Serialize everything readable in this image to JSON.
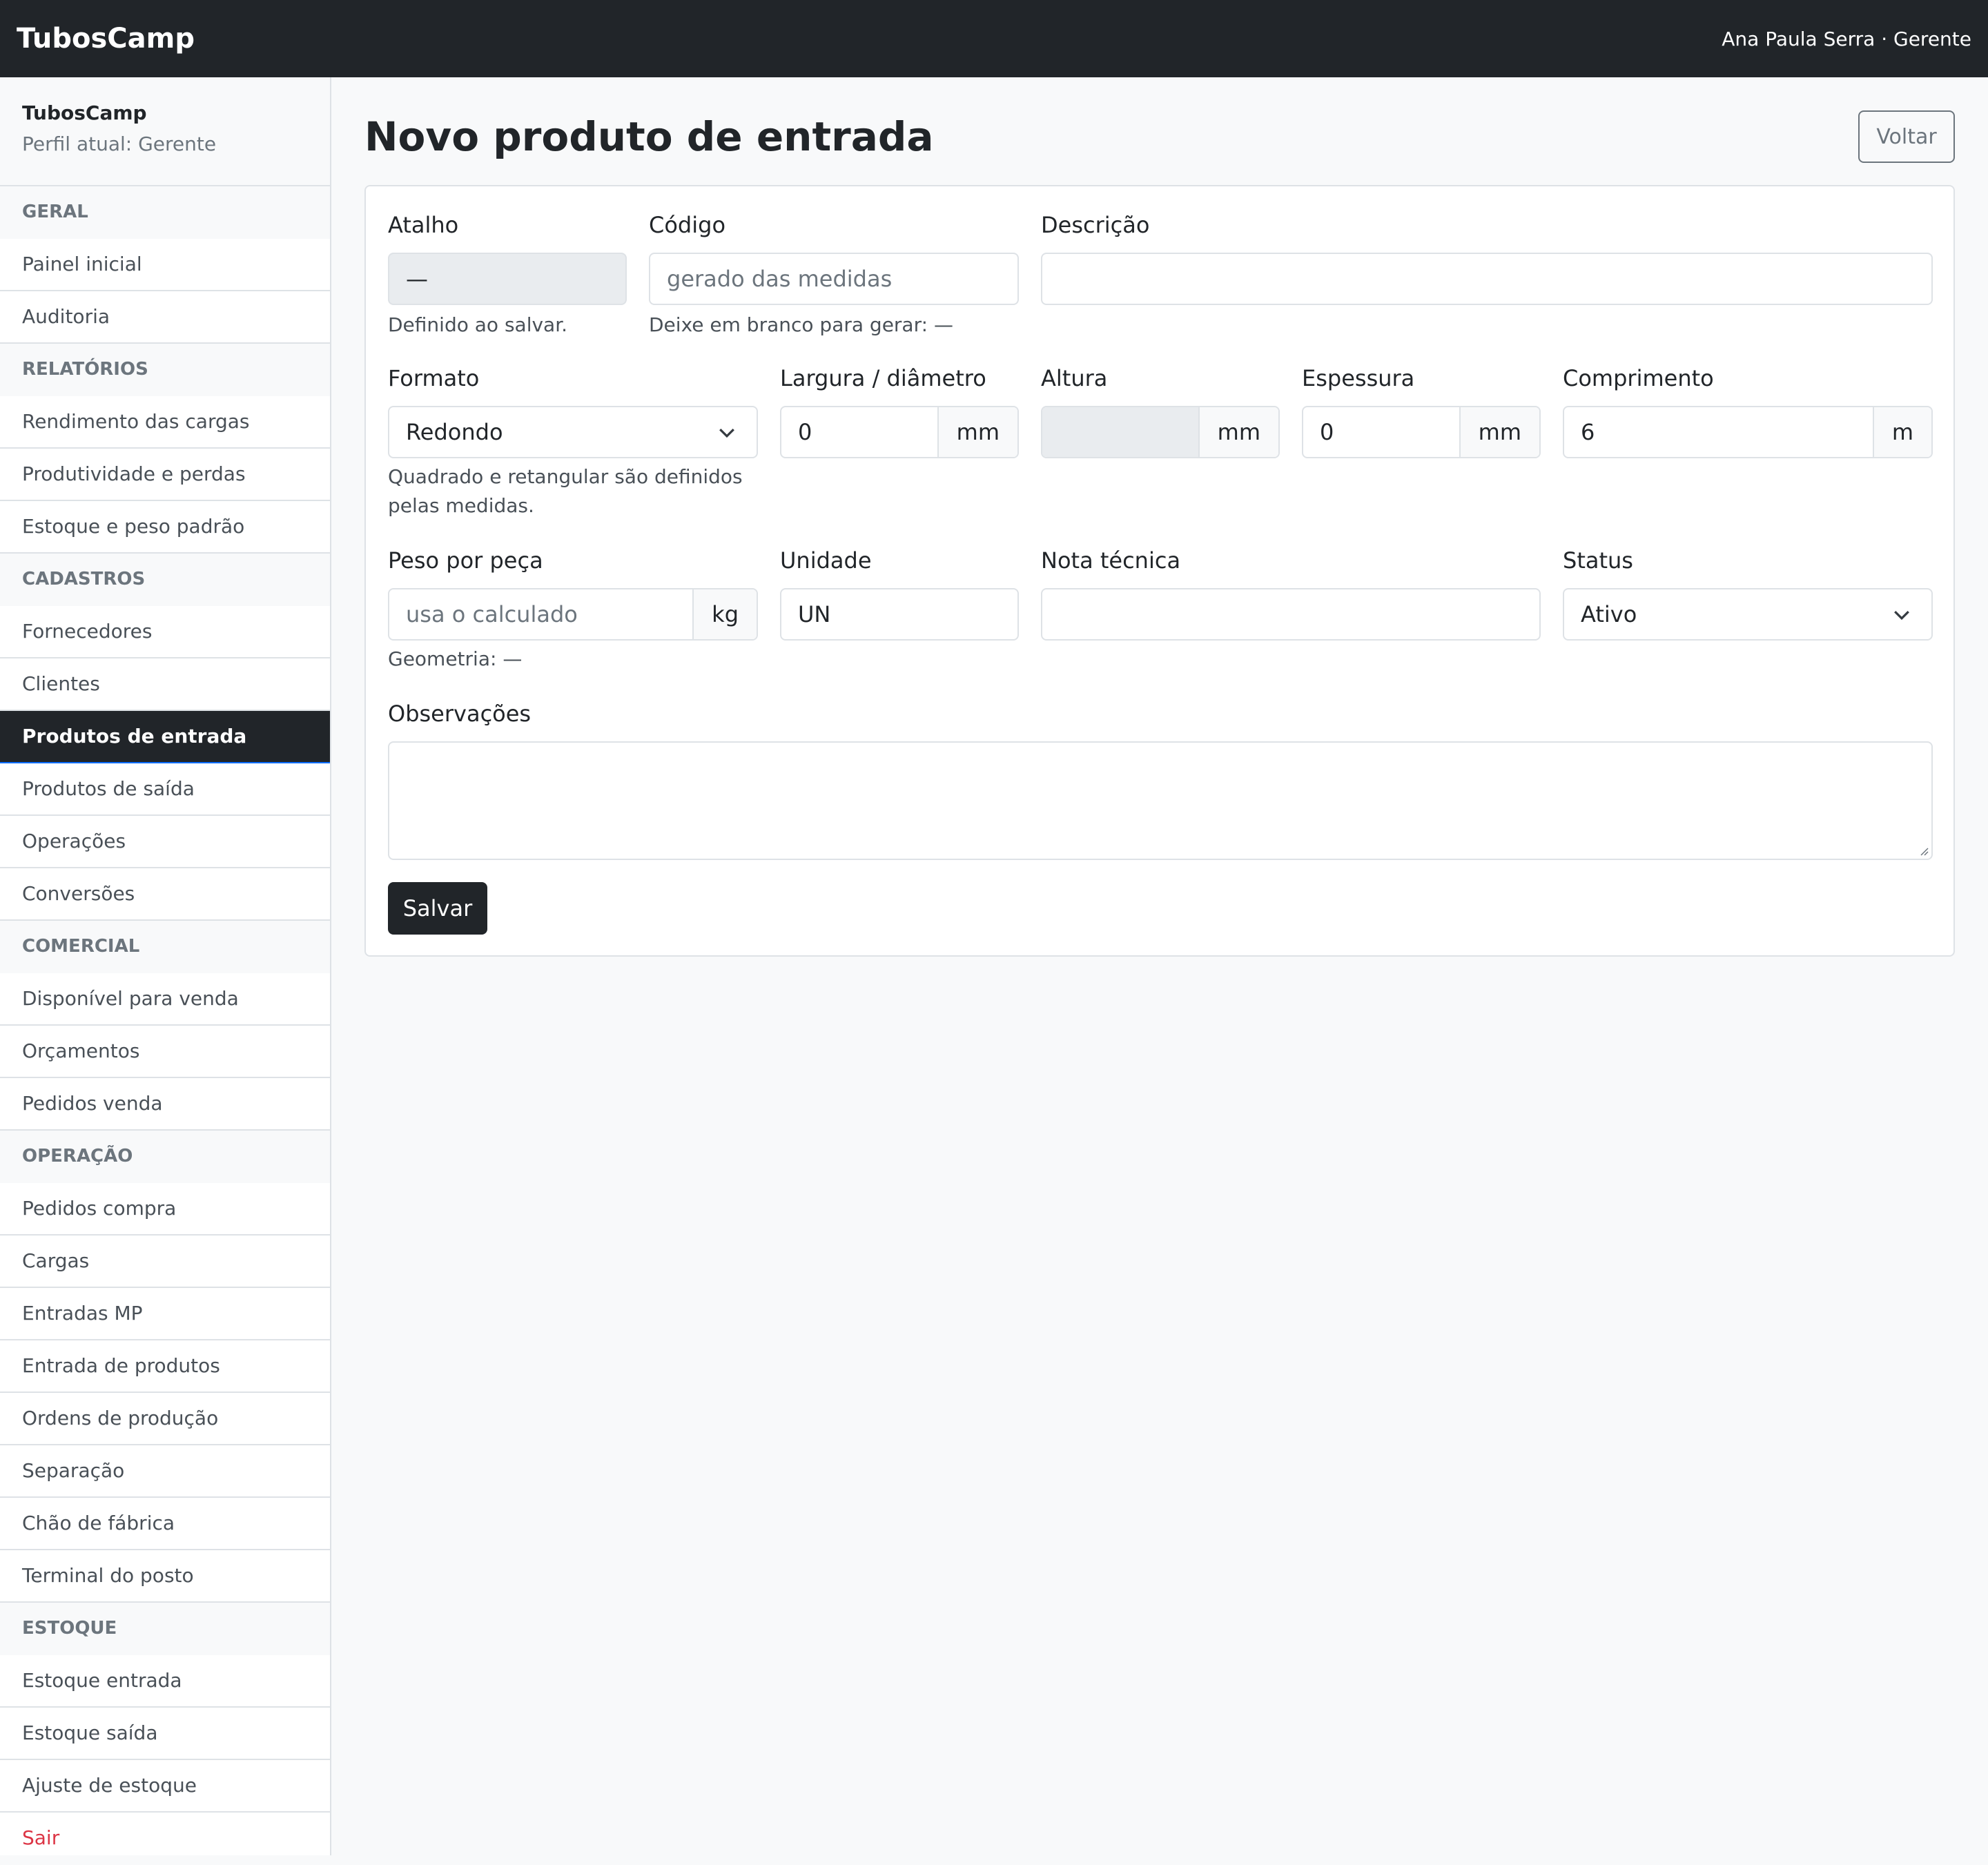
{
  "topbar": {
    "brand": "TubosCamp",
    "user": "Ana Paula Serra · Gerente"
  },
  "sidebar": {
    "app": "TubosCamp",
    "profile": "Perfil atual: Gerente",
    "items": [
      {
        "label": "GERAL",
        "type": "section"
      },
      {
        "label": "Painel inicial"
      },
      {
        "label": "Auditoria"
      },
      {
        "label": "RELATÓRIOS",
        "type": "section"
      },
      {
        "label": "Rendimento das cargas"
      },
      {
        "label": "Produtividade e perdas"
      },
      {
        "label": "Estoque e peso padrão"
      },
      {
        "label": "CADASTROS",
        "type": "section"
      },
      {
        "label": "Fornecedores"
      },
      {
        "label": "Clientes"
      },
      {
        "label": "Produtos de entrada",
        "active": true
      },
      {
        "label": "Produtos de saída"
      },
      {
        "label": "Operações"
      },
      {
        "label": "Conversões"
      },
      {
        "label": "COMERCIAL",
        "type": "section"
      },
      {
        "label": "Disponível para venda"
      },
      {
        "label": "Orçamentos"
      },
      {
        "label": "Pedidos venda"
      },
      {
        "label": "OPERAÇÃO",
        "type": "section"
      },
      {
        "label": "Pedidos compra"
      },
      {
        "label": "Cargas"
      },
      {
        "label": "Entradas MP"
      },
      {
        "label": "Entrada de produtos"
      },
      {
        "label": "Ordens de produção"
      },
      {
        "label": "Separação"
      },
      {
        "label": "Chão de fábrica"
      },
      {
        "label": "Terminal do posto"
      },
      {
        "label": "ESTOQUE",
        "type": "section"
      },
      {
        "label": "Estoque entrada"
      },
      {
        "label": "Estoque saída"
      },
      {
        "label": "Ajuste de estoque"
      },
      {
        "label": "Sair",
        "type": "logout"
      }
    ]
  },
  "page": {
    "title": "Novo produto de entrada",
    "back_label": "Voltar"
  },
  "form": {
    "atalho": {
      "label": "Atalho",
      "value": "—",
      "help": "Definido ao salvar."
    },
    "codigo": {
      "label": "Código",
      "placeholder": "gerado das medidas",
      "help": "Deixe em branco para gerar: —"
    },
    "descricao": {
      "label": "Descrição",
      "value": ""
    },
    "formato": {
      "label": "Formato",
      "value": "Redondo",
      "help1": "Quadrado e retangular são definidos",
      "help2": "pelas medidas."
    },
    "largura": {
      "label": "Largura / diâmetro",
      "value": "0",
      "unit": "mm"
    },
    "altura": {
      "label": "Altura",
      "value": "",
      "unit": "mm"
    },
    "espessura": {
      "label": "Espessura",
      "value": "0",
      "unit": "mm"
    },
    "comprimento": {
      "label": "Comprimento",
      "value": "6",
      "unit": "m"
    },
    "peso": {
      "label": "Peso por peça",
      "placeholder": "usa o calculado",
      "unit": "kg",
      "help": "Geometria: —"
    },
    "unidade": {
      "label": "Unidade",
      "value": "UN"
    },
    "nota": {
      "label": "Nota técnica",
      "value": ""
    },
    "status": {
      "label": "Status",
      "value": "Ativo"
    },
    "observacoes": {
      "label": "Observações"
    },
    "save_label": "Salvar"
  },
  "colors": {
    "dark": "#212529",
    "accent": "#0d6efd",
    "danger": "#dc3545"
  }
}
